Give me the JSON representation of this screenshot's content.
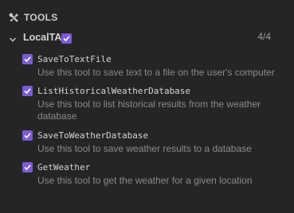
{
  "header": {
    "title": "TOOLS",
    "icon": "tools-icon"
  },
  "group": {
    "name": "LocalTA",
    "count": "4/4",
    "checked": true
  },
  "tools": [
    {
      "name": "SaveToTextFile",
      "description": "Use this tool to save text to a file on the user's computer",
      "checked": true
    },
    {
      "name": "ListHistoricalWeatherDatabase",
      "description": "Use this tool to list historical results from the weather database",
      "checked": true
    },
    {
      "name": "SaveToWeatherDatabase",
      "description": "Use this tool to save weather results to a database",
      "checked": true
    },
    {
      "name": "GetWeather",
      "description": "Use this tool to get the weather for a given location",
      "checked": true
    }
  ],
  "colors": {
    "background": "#252526",
    "checkbox": "#7b5cd6",
    "text": "#cccccc",
    "muted": "#8a8a8a"
  }
}
